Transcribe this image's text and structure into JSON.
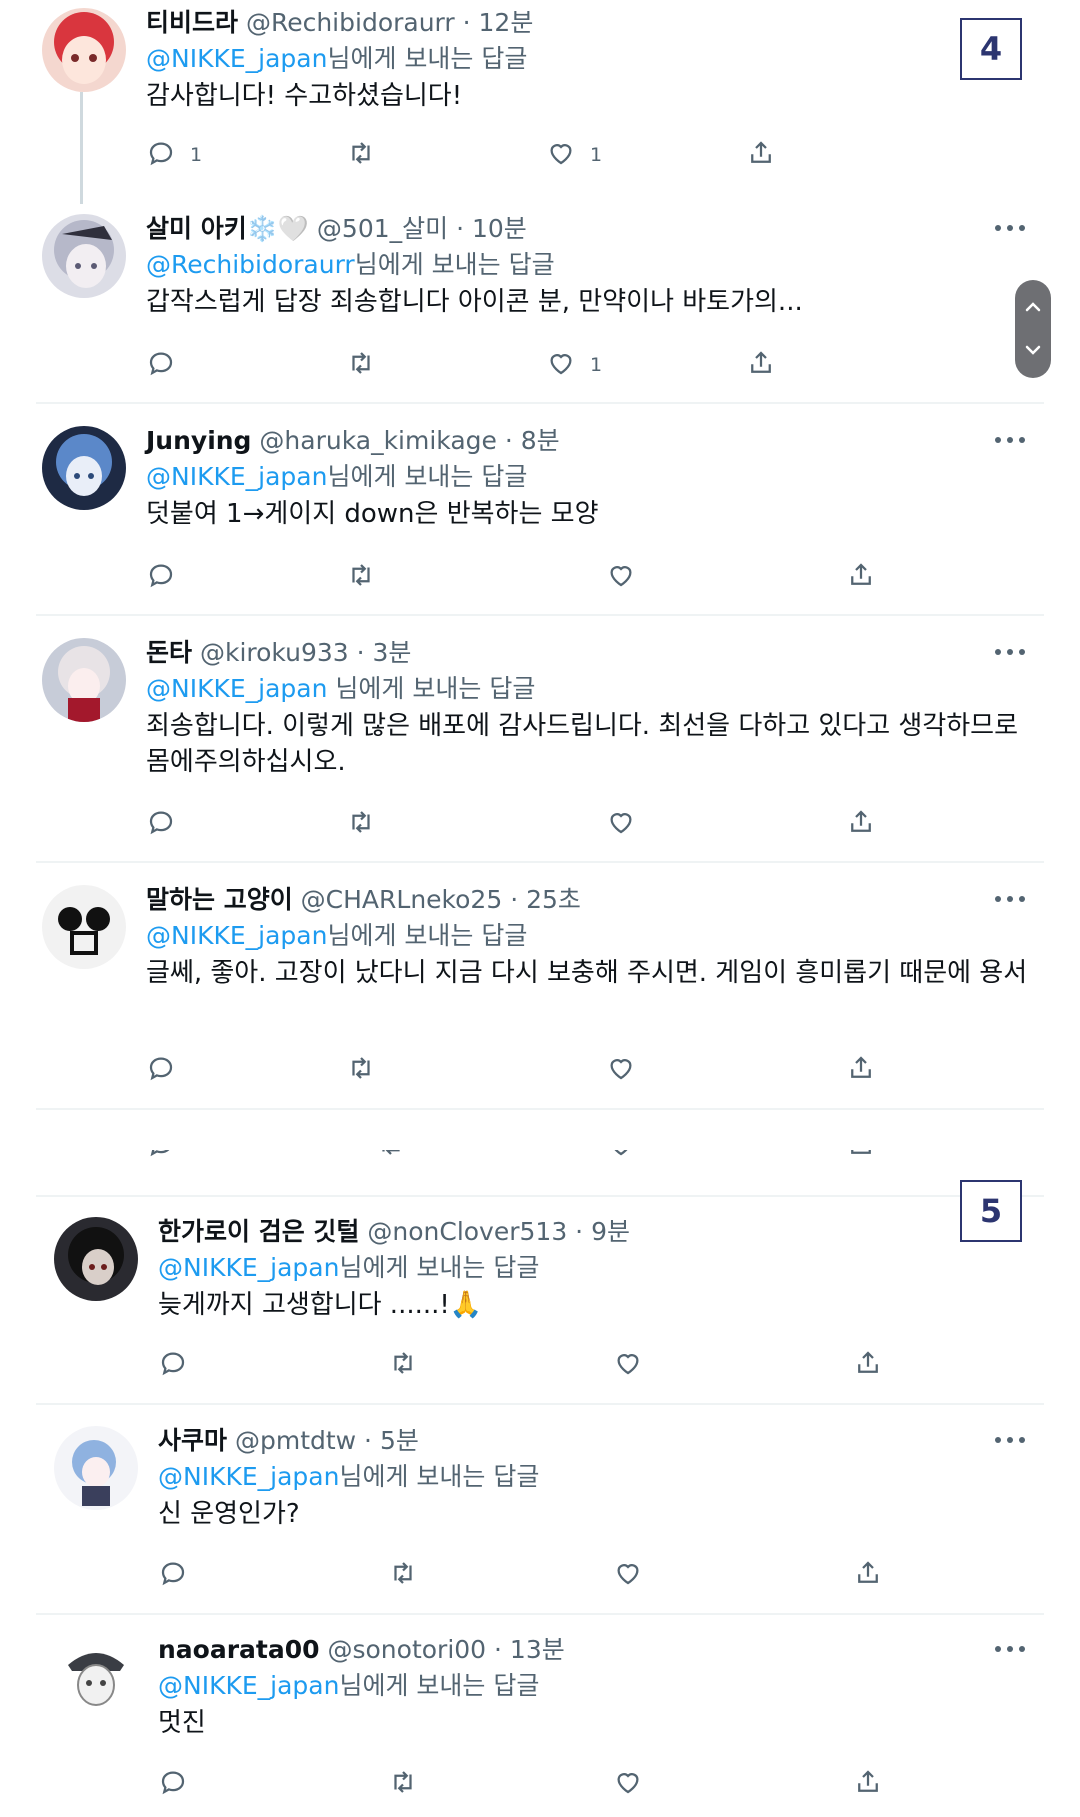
{
  "reply_prefix": "님에게 보내는 답글",
  "markers": [
    "4",
    "5"
  ],
  "icons": {
    "reply": "reply-icon",
    "retweet": "retweet-icon",
    "like": "like-icon",
    "share": "share-icon",
    "more": "more-icon"
  },
  "colors": {
    "mention": "#1d9bf0",
    "secondary": "#536471",
    "divider": "#eff3f4",
    "marker": "#2c3570"
  },
  "tweets": [
    {
      "name": "티비드라",
      "meta": "@Rechibidoraurr · 12분",
      "mention": "@NIKKE_japan",
      "text": "감사합니다! 수고하셨습니다!",
      "reply_count": "1",
      "like_count": "1"
    },
    {
      "name": "살미 아키❄️🤍",
      "meta": "@501_살미 · 10분",
      "mention": "@Rechibidoraurr",
      "text": "갑작스럽게 답장 죄송합니다 아이콘 분, 만약이나 바토가의...",
      "reply_count": "",
      "like_count": "1"
    },
    {
      "name": "Junying",
      "meta": "@haruka_kimikage · 8분",
      "mention": "@NIKKE_japan",
      "text": "덧붙여 1→게이지 down은 반복하는 모양",
      "reply_count": "",
      "like_count": ""
    },
    {
      "name": "돈타",
      "meta": "@kiroku933 · 3분",
      "mention": "@NIKKE_japan",
      "text": "죄송합니다. 이렇게 많은 배포에 감사드립니다. 최선을 다하고 있다고 생각하므로 몸에주의하십시오.",
      "reply_count": "",
      "like_count": ""
    },
    {
      "name": "말하는 고양이",
      "meta": "@CHARLneko25 · 25초",
      "mention": "@NIKKE_japan",
      "text": "글쎄, 좋아. 고장이 났다니 지금 다시 보충해 주시면. 게임이 흥미롭기 때문에 용서",
      "reply_count": "",
      "like_count": ""
    },
    {
      "name": "한가로이 검은 깃털",
      "meta": "@nonClover513 · 9분",
      "mention": "@NIKKE_japan",
      "text": "늦게까지 고생합니다 ......!🙏",
      "reply_count": "",
      "like_count": ""
    },
    {
      "name": "사쿠마",
      "meta": "@pmtdtw · 5분",
      "mention": "@NIKKE_japan",
      "text": "신 운영인가?",
      "reply_count": "",
      "like_count": ""
    },
    {
      "name": "naoarata00",
      "meta": "@sonotori00 · 13분",
      "mention": "@NIKKE_japan",
      "text": "멋진",
      "reply_count": "",
      "like_count": ""
    }
  ]
}
